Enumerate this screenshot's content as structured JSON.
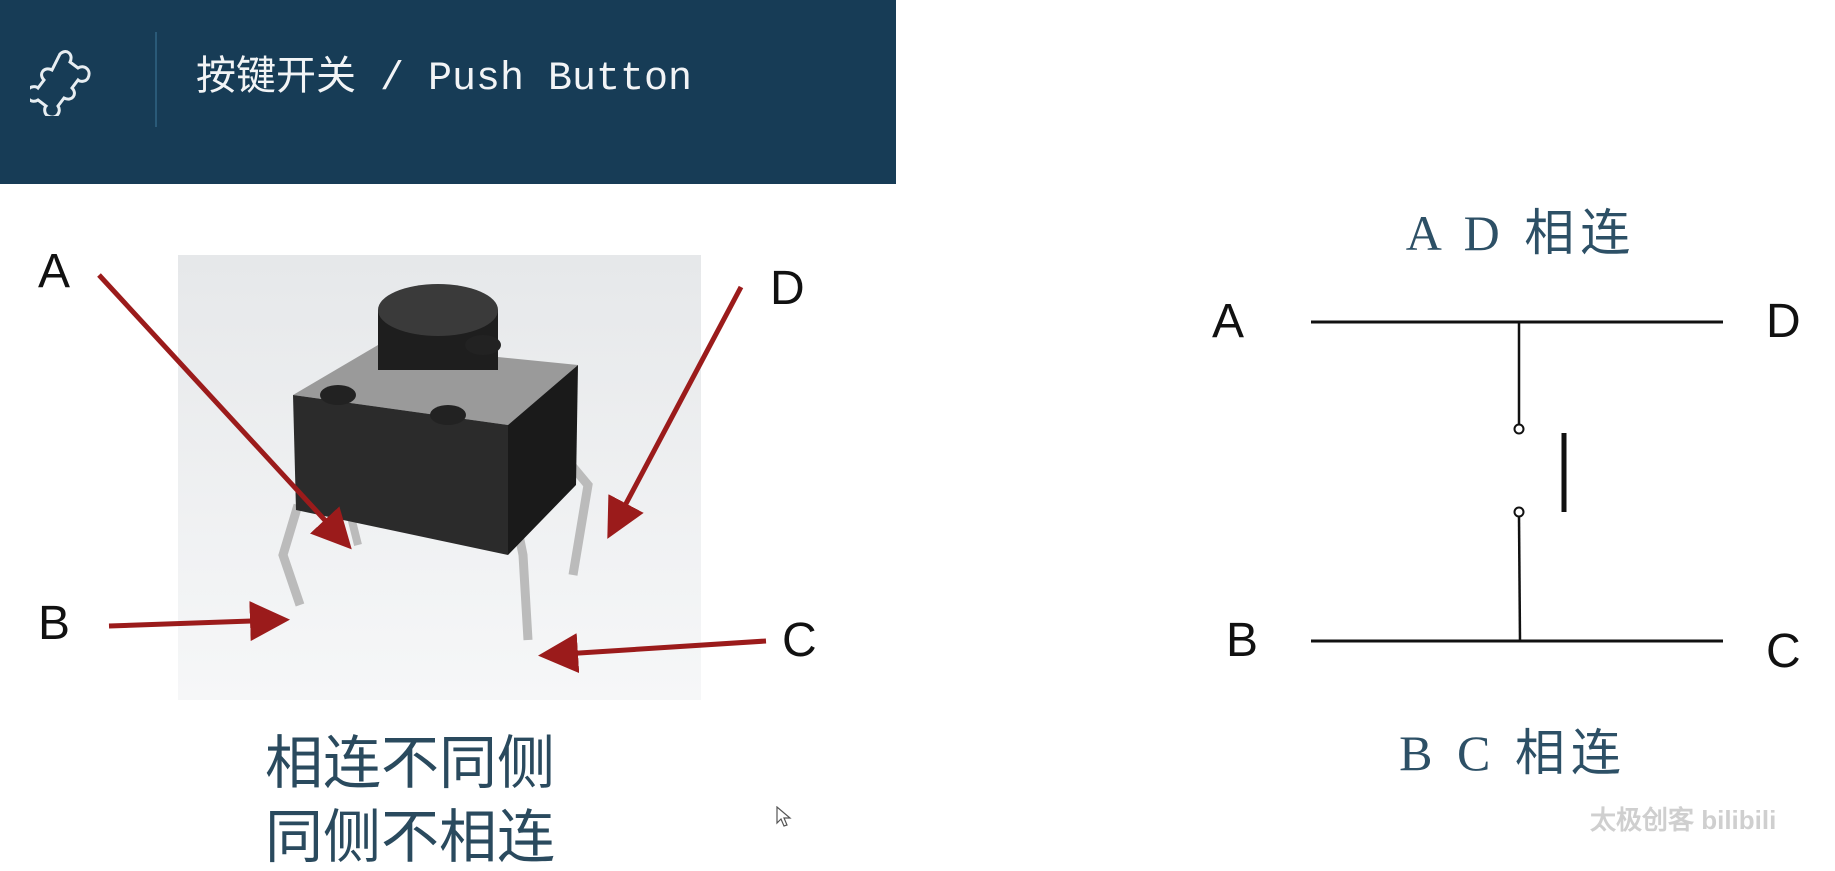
{
  "header": {
    "title": "按键开关 / Push Button",
    "icon": "puzzle-icon"
  },
  "photo_labels": {
    "a": "A",
    "b": "B",
    "c": "C",
    "d": "D"
  },
  "captions": [
    "相连不同侧",
    "同侧不相连"
  ],
  "diagram": {
    "labels": {
      "a": "A",
      "b": "B",
      "c": "C",
      "d": "D"
    },
    "top_text": "A D 相连",
    "bottom_text": "B C 相连"
  },
  "watermark": "太极创客 bilibili",
  "colors": {
    "header_bg": "#173c56",
    "arrow": "#9b1b1b",
    "caption": "#2a4a5e"
  }
}
